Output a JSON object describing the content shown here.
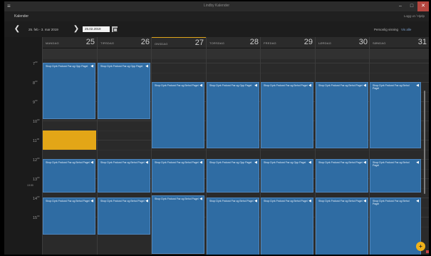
{
  "window": {
    "title": "Lindby Kalender",
    "minimize": "–",
    "maximize": "□",
    "close": "✕"
  },
  "appbar": {
    "label": "Kalender",
    "right": "Logg ut / Hjelp"
  },
  "toolbar": {
    "prev_glyph": "❮",
    "next_glyph": "❯",
    "range": "25. feb - 3. mar 2019",
    "date_value": "25.02.2019",
    "right_link1": "Personlig visning",
    "right_link2": "Vis alle"
  },
  "days": [
    {
      "name": "MANDAG",
      "num": "25",
      "today": false
    },
    {
      "name": "TIRSDAG",
      "num": "26",
      "today": false
    },
    {
      "name": "ONSDAG",
      "num": "27",
      "today": true
    },
    {
      "name": "TORSDAG",
      "num": "28",
      "today": false
    },
    {
      "name": "FREDAG",
      "num": "29",
      "today": false
    },
    {
      "name": "LØRDAG",
      "num": "30",
      "today": false
    },
    {
      "name": "SØNDAG",
      "num": "31",
      "today": false
    }
  ],
  "hours": [
    {
      "h": "7",
      "m": "00"
    },
    {
      "h": "8",
      "m": "00"
    },
    {
      "h": "9",
      "m": "00"
    },
    {
      "h": "10",
      "m": "00"
    },
    {
      "h": "11",
      "m": "00"
    },
    {
      "h": "12",
      "m": "00"
    },
    {
      "h": "13",
      "m": "00"
    },
    {
      "h": "14",
      "m": "00"
    },
    {
      "h": "15",
      "m": "00"
    }
  ],
  "now_label": "13:30",
  "events": [
    {
      "day": 0,
      "start": 0,
      "end": 3,
      "title": "Shop Dyrk Frokost Frø og Opp Pagel"
    },
    {
      "day": 1,
      "start": 0,
      "end": 3,
      "title": "Shop Dyrk Frokost Frø og Opp Pagel"
    },
    {
      "day": 2,
      "start": 1,
      "end": 4.5,
      "title": "Shop Dyrk Frokost Frø og Behol Pagel"
    },
    {
      "day": 3,
      "start": 1,
      "end": 4.5,
      "title": "Shop Dyrk Frokost Frø og Opp Pagel"
    },
    {
      "day": 4,
      "start": 1,
      "end": 4.5,
      "title": "Shop Dyrk Frokost Frø og Behol Pagel"
    },
    {
      "day": 5,
      "start": 1,
      "end": 4.5,
      "title": "Shop Dyrk Frokost Frø og Behol Pagel"
    },
    {
      "day": 6,
      "start": 1,
      "end": 4.5,
      "title": "Shop Dyrk Frokost Frø og Behol Pagel"
    },
    {
      "day": 0,
      "start": 5,
      "end": 6.8,
      "title": "Shop Dyrk Frokost Frø og Behol Pagel"
    },
    {
      "day": 1,
      "start": 5,
      "end": 6.8,
      "title": "Shop Dyrk Frokost Frø og Behol Pagel"
    },
    {
      "day": 2,
      "start": 5,
      "end": 6.8,
      "title": "Shop Dyrk Frokost Frø og Behol Pagel"
    },
    {
      "day": 3,
      "start": 5,
      "end": 6.8,
      "title": "Shop Dyrk Frokost Frø og Opp Pagel"
    },
    {
      "day": 4,
      "start": 5,
      "end": 6.8,
      "title": "Shop Dyrk Frokost Frø og Opp Pagel"
    },
    {
      "day": 5,
      "start": 5,
      "end": 6.8,
      "title": "Shop Dyrk Frokost Frø og Behol Pagel"
    },
    {
      "day": 6,
      "start": 5,
      "end": 6.8,
      "title": "Shop Dyrk Frokost Frø og Behol Pagel"
    },
    {
      "day": 2,
      "start": 6.9,
      "end": 10,
      "title": "Shop Dyrk Frokost Frø og Behol Pagel"
    },
    {
      "day": 0,
      "start": 7,
      "end": 9,
      "title": "Shop Dyrk Frokost Frø og Behol Pagel"
    },
    {
      "day": 1,
      "start": 7,
      "end": 9,
      "title": "Shop Dyrk Frokost Frø og Behol Pagel"
    },
    {
      "day": 3,
      "start": 7,
      "end": 10.2,
      "title": "Shop Dyrk Frokost Frø og Behol Pagel"
    },
    {
      "day": 4,
      "start": 7,
      "end": 10.2,
      "title": "Shop Dyrk Frokost Frø og Behol Pagel"
    },
    {
      "day": 5,
      "start": 7,
      "end": 10.2,
      "title": "Shop Dyrk Frokost Frø og Behol Pagel"
    },
    {
      "day": 6,
      "start": 7,
      "end": 10.2,
      "title": "Shop Dyrk Frokost Frø og Behol Pagel"
    }
  ],
  "highlight": {
    "day": 0,
    "start": 3.5,
    "end": 4.5
  },
  "event_icon": "◀",
  "fab_icon": "+",
  "colors": {
    "event": "#2f6ca3",
    "highlight": "#e3a617",
    "today_accent": "#e0a61b",
    "close_button": "#b5463f"
  }
}
